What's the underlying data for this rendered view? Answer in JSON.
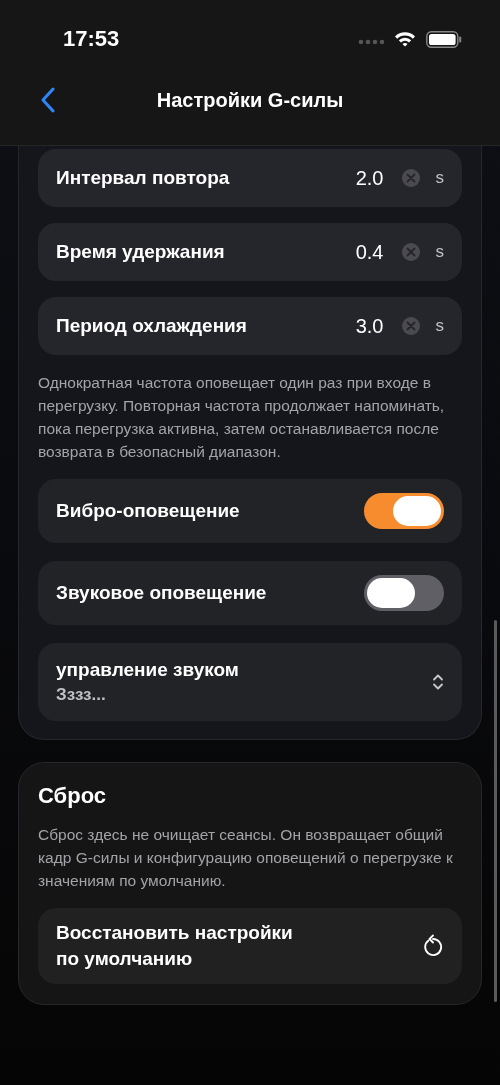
{
  "status_bar": {
    "time": "17:53"
  },
  "nav": {
    "title": "Настройки G-силы"
  },
  "alerts_card": {
    "rows": [
      {
        "kind": "number",
        "label": "Интервал повтора",
        "value": "2.0",
        "unit": "s"
      },
      {
        "kind": "number",
        "label": "Время удержания",
        "value": "0.4",
        "unit": "s"
      },
      {
        "kind": "number",
        "label": "Период охлаждения",
        "value": "3.0",
        "unit": "s"
      }
    ],
    "note": "Однократная частота оповещает один раз при входе в перегрузку. Повторная частота продолжает напоминать, пока перегрузка активна, затем останавливается после возврата в безопасный диапазон.",
    "settings": [
      {
        "kind": "toggle",
        "label": "Вибро-оповещение",
        "on": true
      },
      {
        "kind": "toggle",
        "label": "Звуковое оповещение",
        "on": false
      },
      {
        "kind": "picker",
        "label": "управление звуком",
        "value": "Зззз..."
      }
    ]
  },
  "reset_card": {
    "title": "Сброс",
    "description": "Сброс здесь не очищает сеансы. Он возвращает общий кадр G-силы и конфигурацию оповещений о перегрузке к значениям по умолчанию.",
    "button": "Восстановить настройки по умолчанию"
  }
}
